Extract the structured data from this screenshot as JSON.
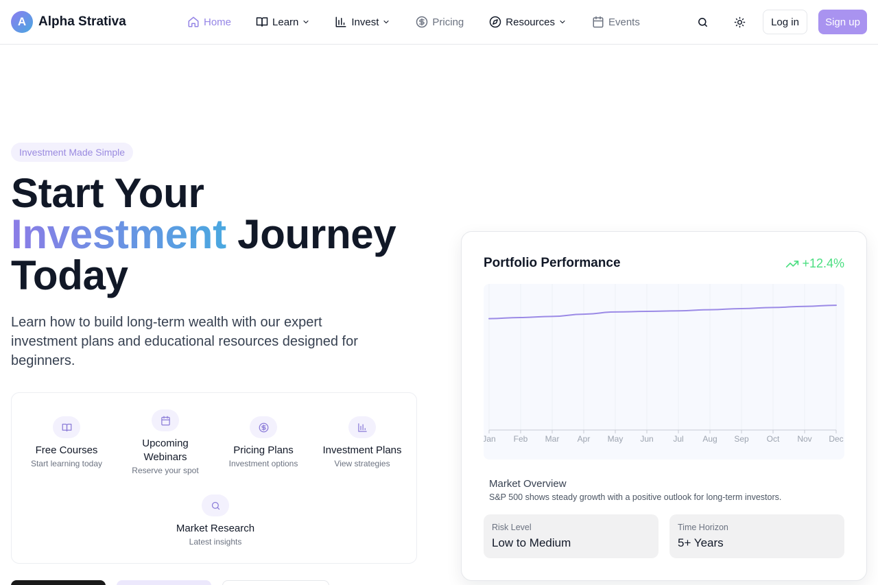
{
  "brand": {
    "logo_letter": "A",
    "name": "Alpha Strativa"
  },
  "nav": {
    "home": "Home",
    "learn": "Learn",
    "invest": "Invest",
    "pricing": "Pricing",
    "resources": "Resources",
    "events": "Events"
  },
  "header_actions": {
    "login": "Log in",
    "signup": "Sign up"
  },
  "hero": {
    "badge": "Investment Made Simple",
    "title_line1": "Start Your",
    "title_highlight": "Investment",
    "title_line2_rest": " Journey",
    "title_line3": "Today",
    "subtitle": "Learn how to build long-term wealth with our expert investment plans and educational resources designed for beginners."
  },
  "features": [
    {
      "title": "Free Courses",
      "subtitle": "Start learning today",
      "icon": "book-icon"
    },
    {
      "title": "Upcoming Webinars",
      "subtitle": "Reserve your spot",
      "icon": "calendar-icon"
    },
    {
      "title": "Pricing Plans",
      "subtitle": "Investment options",
      "icon": "dollar-icon"
    },
    {
      "title": "Investment Plans",
      "subtitle": "View strategies",
      "icon": "bar-chart-icon"
    },
    {
      "title": "Market Research",
      "subtitle": "Latest insights",
      "icon": "search-icon"
    }
  ],
  "portfolio": {
    "title": "Portfolio Performance",
    "change": "+12.4%",
    "market_title": "Market Overview",
    "market_text": "S&P 500 shows steady growth with a positive outlook for long-term investors.",
    "risk_label": "Risk Level",
    "risk_value": "Low to Medium",
    "horizon_label": "Time Horizon",
    "horizon_value": "5+ Years"
  },
  "colors": {
    "accent": "#a993f0",
    "accent_soft": "#f3f1fd",
    "positive": "#4ade80",
    "line": "#9b8ae6"
  },
  "chart_data": {
    "type": "line",
    "categories": [
      "Jan",
      "Feb",
      "Mar",
      "Apr",
      "May",
      "Jun",
      "Jul",
      "Aug",
      "Sep",
      "Oct",
      "Nov",
      "Dec"
    ],
    "series": [
      {
        "values": [
          100,
          101,
          102,
          104,
          106,
          106.5,
          107,
          108,
          109,
          110,
          111,
          112
        ]
      }
    ],
    "ylim": [
      0,
      125
    ],
    "grid": true,
    "legend": "none"
  }
}
